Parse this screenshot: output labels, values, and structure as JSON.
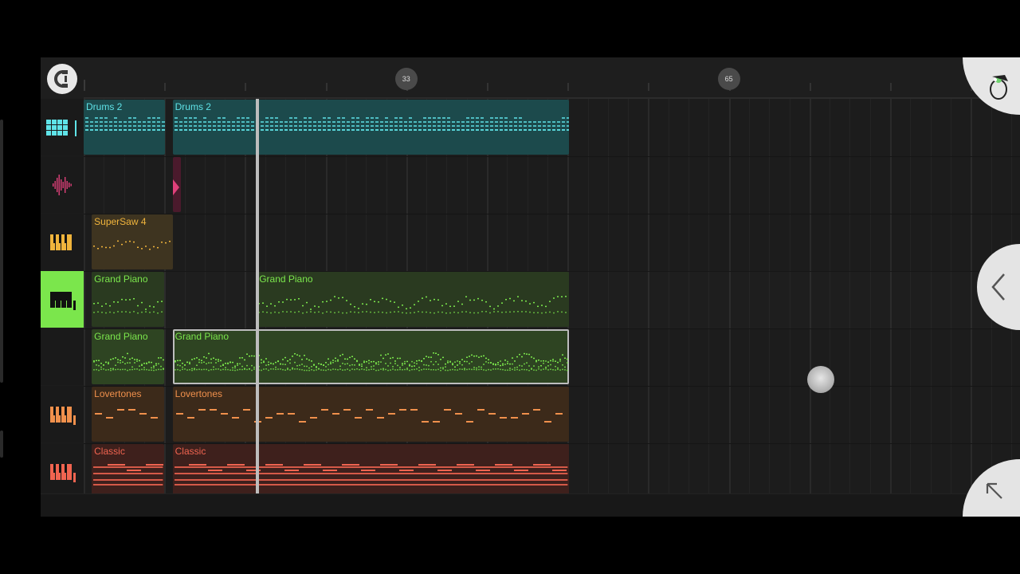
{
  "ruler": {
    "markers": [
      {
        "label": "33",
        "bar": 33
      },
      {
        "label": "65",
        "bar": 65
      }
    ]
  },
  "icons": {
    "snap": "magnet-icon",
    "app_logo": "fl-studio-fruit-icon",
    "collapse": "chevron-left-icon",
    "expand": "arrow-up-left-icon"
  },
  "tracks": [
    {
      "name": "drums-track",
      "icon": "step-sequencer-icon",
      "color": "#5fe3e8",
      "selected": false,
      "clips": [
        {
          "label": "Drums 2",
          "start": 0,
          "end": 0.5,
          "selected": false,
          "style": "drums"
        },
        {
          "label": "Drums 2",
          "start": 0.55,
          "end": 3.0,
          "selected": false,
          "style": "drums"
        }
      ]
    },
    {
      "name": "audio-track",
      "icon": "waveform-icon",
      "color": "#e0407a",
      "selected": false,
      "clips": [
        {
          "label": "",
          "start": 0.55,
          "end": 0.6,
          "selected": false,
          "style": "audio"
        }
      ]
    },
    {
      "name": "supersaw-track",
      "icon": "piano-keys-icon",
      "color": "#f0b43c",
      "selected": false,
      "clips": [
        {
          "label": "SuperSaw 4",
          "start": 0.05,
          "end": 0.55,
          "selected": false,
          "style": "synth"
        }
      ]
    },
    {
      "name": "grand-piano-track-1",
      "icon": "piano-keys-icon",
      "color": "#7be64c",
      "selected": true,
      "clips": [
        {
          "label": "Grand Piano",
          "start": 0.05,
          "end": 0.5,
          "selected": false,
          "style": "piano"
        },
        {
          "label": "Grand Piano",
          "start": 1.07,
          "end": 3.0,
          "selected": false,
          "style": "piano"
        }
      ]
    },
    {
      "name": "grand-piano-track-2",
      "icon": "",
      "color": "#7be64c",
      "selected": false,
      "clips": [
        {
          "label": "Grand Piano",
          "start": 0.05,
          "end": 0.5,
          "selected": false,
          "style": "piano-dense"
        },
        {
          "label": "Grand Piano",
          "start": 0.55,
          "end": 3.0,
          "selected": true,
          "style": "piano-dense"
        }
      ]
    },
    {
      "name": "lovertones-track",
      "icon": "piano-keys-icon",
      "color": "#f0904c",
      "selected": false,
      "clips": [
        {
          "label": "Lovertones",
          "start": 0.05,
          "end": 0.5,
          "selected": false,
          "style": "bass"
        },
        {
          "label": "Lovertones",
          "start": 0.55,
          "end": 3.0,
          "selected": false,
          "style": "bass"
        }
      ]
    },
    {
      "name": "classic-track",
      "icon": "piano-keys-icon",
      "color": "#f06450",
      "selected": false,
      "clips": [
        {
          "label": "Classic",
          "start": 0.05,
          "end": 0.5,
          "selected": false,
          "style": "chords"
        },
        {
          "label": "Classic",
          "start": 0.55,
          "end": 3.0,
          "selected": false,
          "style": "chords"
        }
      ]
    }
  ]
}
